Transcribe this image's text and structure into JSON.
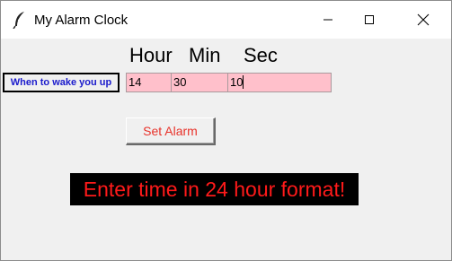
{
  "window": {
    "title": "My Alarm Clock",
    "icon": "feather-icon",
    "controls": [
      "minimize-icon",
      "maximize-icon",
      "close-icon"
    ]
  },
  "headers": {
    "hour": "Hour",
    "min": "Min",
    "sec": "Sec"
  },
  "wake_label": "When to wake you up",
  "fields": {
    "hour": "14",
    "min": "30",
    "sec": "10"
  },
  "set_button": "Set Alarm",
  "hint": "Enter time in 24 hour format!",
  "colors": {
    "field_bg": "#ffc0cb",
    "label_text": "#1a1acc",
    "button_text": "#e8322a",
    "hint_bg": "#000000",
    "hint_text": "#ff1a1a"
  }
}
